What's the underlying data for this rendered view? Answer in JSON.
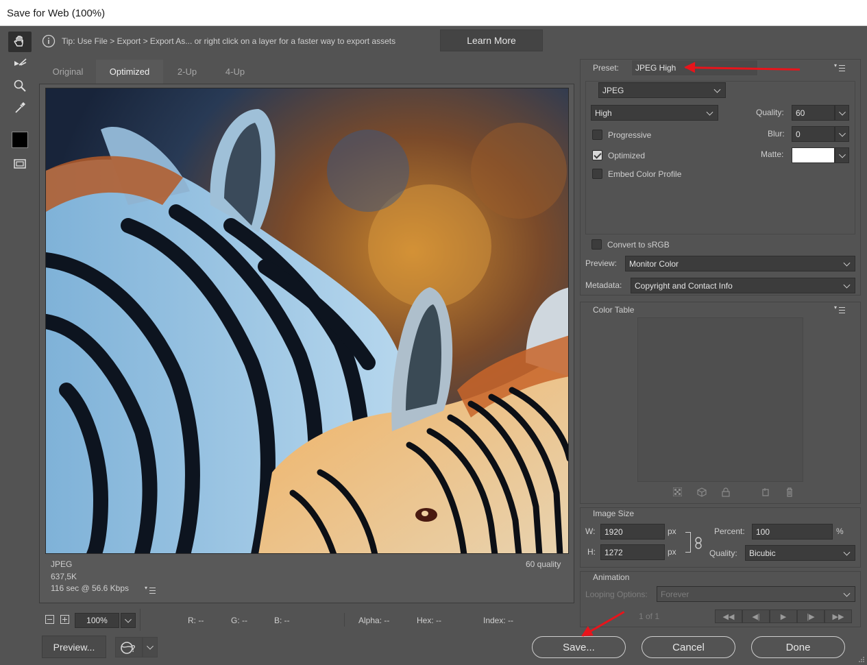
{
  "window": {
    "title": "Save for Web (100%)"
  },
  "tip": {
    "text": "Tip: Use File > Export > Export As...  or right click on a layer for a faster way to export assets",
    "learn_more": "Learn More"
  },
  "tabs": [
    "Original",
    "Optimized",
    "2-Up",
    "4-Up"
  ],
  "active_tab": "Optimized",
  "image_info": {
    "format": "JPEG",
    "size": "637,5K",
    "time": "116 sec @ 56.6 Kbps",
    "quality": "60 quality"
  },
  "zoom": {
    "value": "100%"
  },
  "pixel_info": {
    "r": "R: --",
    "g": "G: --",
    "b": "B: --",
    "alpha": "Alpha: --",
    "hex": "Hex: --",
    "index": "Index: --"
  },
  "settings": {
    "preset_label": "Preset:",
    "preset_value": "JPEG High",
    "format": "JPEG",
    "quality_level": "High",
    "quality_label": "Quality:",
    "quality_value": "60",
    "blur_label": "Blur:",
    "blur_value": "0",
    "matte_label": "Matte:",
    "matte_color": "#ffffff",
    "progressive": {
      "label": "Progressive",
      "checked": false
    },
    "optimized": {
      "label": "Optimized",
      "checked": true
    },
    "embed_profile": {
      "label": "Embed Color Profile",
      "checked": false
    },
    "convert_srgb": {
      "label": "Convert to sRGB",
      "checked": false
    },
    "preview_label": "Preview:",
    "preview_value": "Monitor Color",
    "metadata_label": "Metadata:",
    "metadata_value": "Copyright and Contact Info"
  },
  "color_table": {
    "title": "Color Table"
  },
  "image_size": {
    "title": "Image Size",
    "w_label": "W:",
    "w_value": "1920",
    "h_label": "H:",
    "h_value": "1272",
    "unit": "px",
    "percent_label": "Percent:",
    "percent_value": "100",
    "percent_unit": "%",
    "quality_label": "Quality:",
    "quality_value": "Bicubic"
  },
  "animation": {
    "title": "Animation",
    "looping_label": "Looping Options:",
    "looping_value": "Forever",
    "frame": "1 of 1"
  },
  "buttons": {
    "preview": "Preview...",
    "save": "Save...",
    "cancel": "Cancel",
    "done": "Done"
  },
  "colors": {
    "annotation_arrow": "#e8141b",
    "panel_bg": "#535353"
  }
}
